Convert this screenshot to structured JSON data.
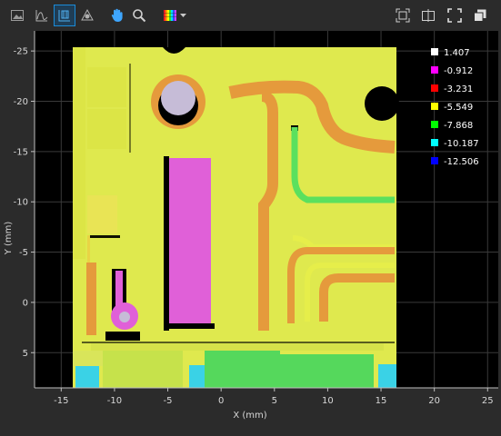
{
  "toolbar": {
    "left": [
      {
        "name": "image-view-icon",
        "active": false
      },
      {
        "name": "profile-view-icon",
        "active": false
      },
      {
        "name": "height-map-view-icon",
        "active": true
      },
      {
        "name": "3d-view-icon",
        "active": false
      },
      {
        "name": "pan-hand-icon",
        "active": false
      },
      {
        "name": "zoom-icon",
        "active": false
      },
      {
        "name": "colormap-dropdown-icon",
        "active": false
      }
    ],
    "right": [
      {
        "name": "fit-view-icon"
      },
      {
        "name": "split-view-icon"
      },
      {
        "name": "fullscreen-icon"
      },
      {
        "name": "float-window-icon"
      }
    ]
  },
  "chart_data": {
    "type": "heatmap",
    "xlabel": "X (mm)",
    "ylabel": "Y (mm)",
    "xlim": [
      -17.5,
      26
    ],
    "ylim": [
      -27,
      8.5
    ],
    "y_axis_inverted": true,
    "x_ticks": [
      -15,
      -10,
      -5,
      0,
      5,
      10,
      15,
      20,
      25
    ],
    "y_ticks": [
      -25,
      -20,
      -15,
      -10,
      -5,
      0,
      5
    ],
    "grid": true,
    "legend": [
      {
        "label": "1.407",
        "color": "#ffffff"
      },
      {
        "label": "-0.912",
        "color": "#ff00ff"
      },
      {
        "label": "-3.231",
        "color": "#ff0000"
      },
      {
        "label": "-5.549",
        "color": "#ffff00"
      },
      {
        "label": "-7.868",
        "color": "#00ff00"
      },
      {
        "label": "-10.187",
        "color": "#00ffff"
      },
      {
        "label": "-12.506",
        "color": "#0000ff"
      }
    ],
    "legend_position": "top-right",
    "colors": {
      "surface": "#e6ee4a",
      "plate_base": "#d5e64a",
      "raised_orange": "#e59a3c",
      "pocket_magenta": "#e060d8",
      "low_green": "#55d85c",
      "low_cyan": "#3ad2e6",
      "hole": "#000000"
    }
  }
}
